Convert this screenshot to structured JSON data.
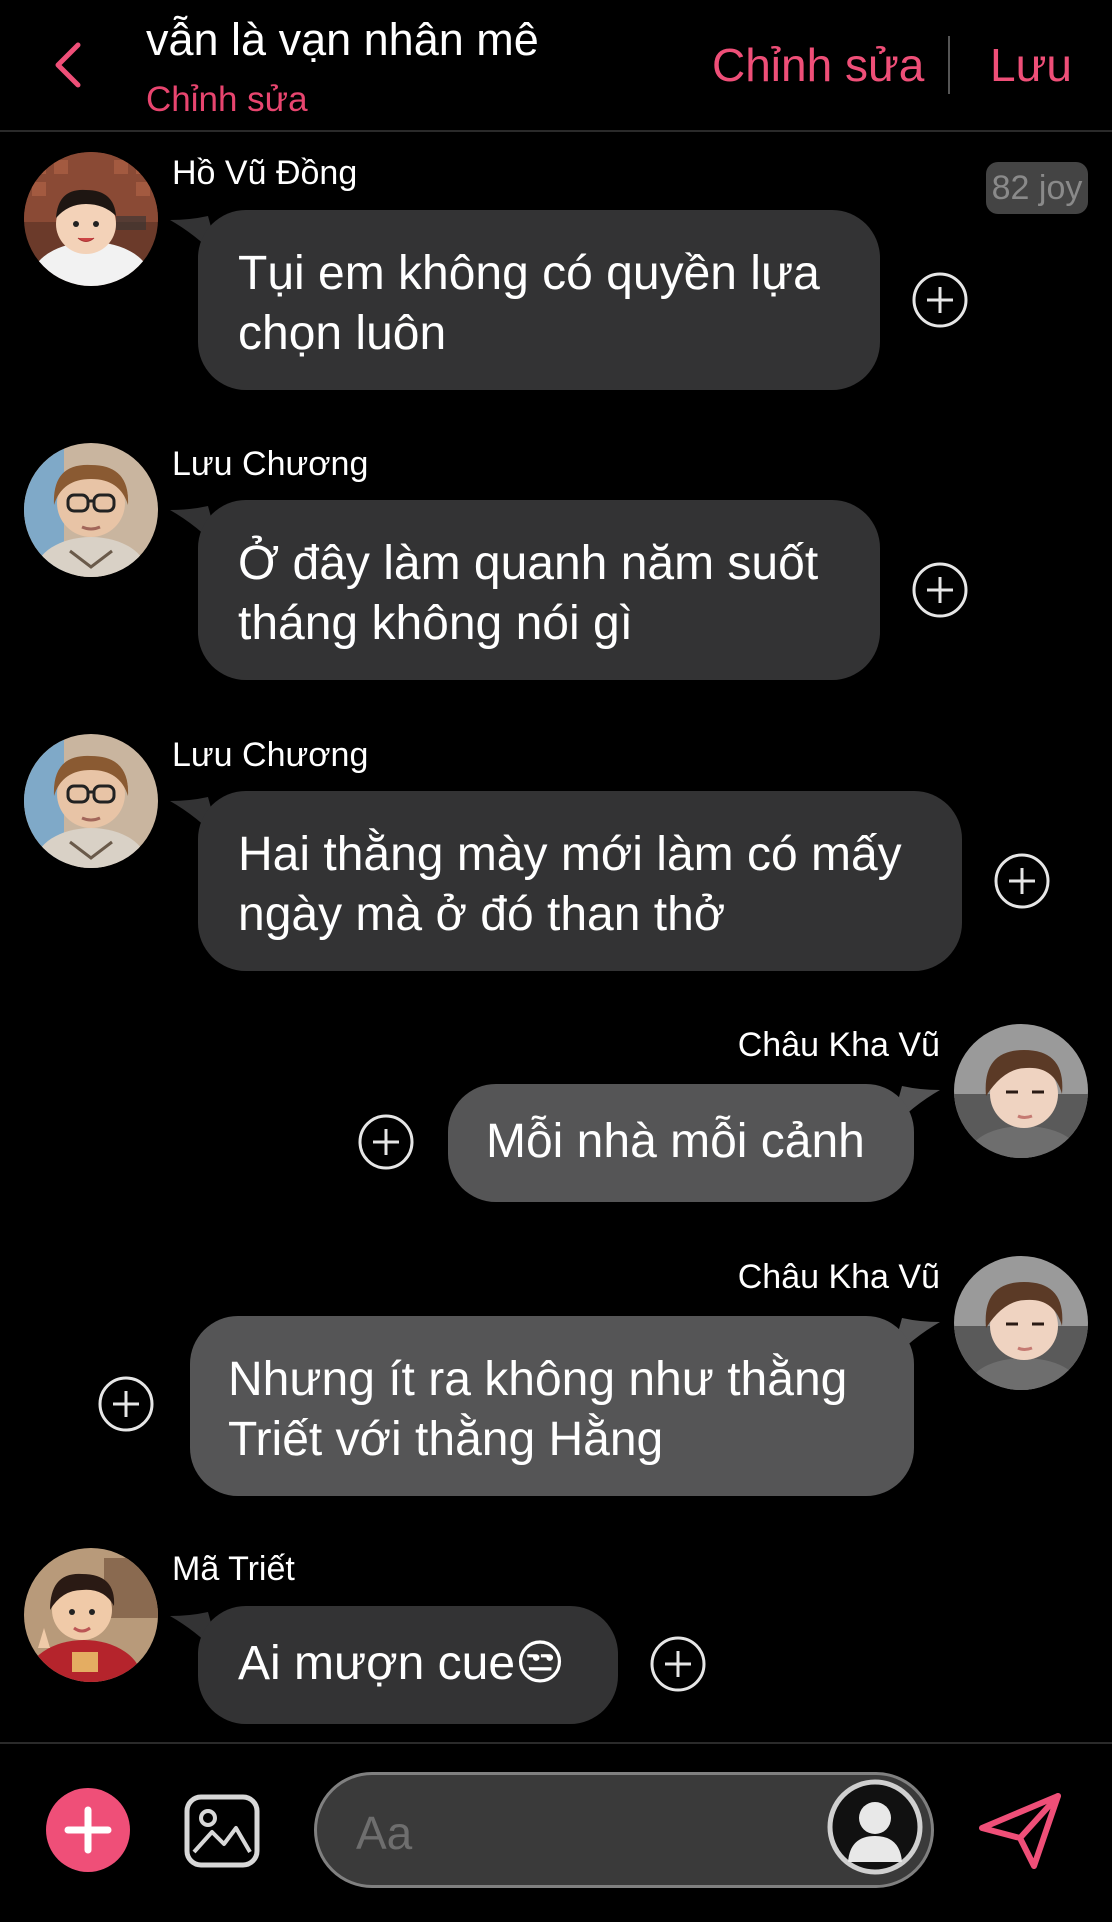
{
  "header": {
    "title": "vẫn là vạn nhân mê",
    "subtitle": "Chỉnh sửa",
    "edit_label": "Chỉnh sửa",
    "save_label": "Lưu",
    "back_icon": "chevron-left-icon"
  },
  "badge": {
    "text": "82 joy"
  },
  "messages": [
    {
      "sender": "Hồ Vũ Đồng",
      "text": [
        "Tụi em không có quyền lựa",
        "chọn luôn"
      ],
      "direction": "incoming"
    },
    {
      "sender": "Lưu Chương",
      "text": [
        "Ở đây làm quanh năm suốt",
        "tháng không nói gì"
      ],
      "direction": "incoming"
    },
    {
      "sender": "Lưu Chương",
      "text": [
        "Hai thằng mày mới làm có mấy",
        "ngày mà ở đó than thở"
      ],
      "direction": "incoming"
    },
    {
      "sender": "Châu Kha Vũ",
      "text": [
        "Mỗi nhà mỗi cảnh"
      ],
      "direction": "outgoing"
    },
    {
      "sender": "Châu Kha Vũ",
      "text": [
        "Nhưng ít ra không như thằng",
        "Triết với thằng Hằng"
      ],
      "direction": "outgoing"
    },
    {
      "sender": "Mã Triết",
      "text": [
        "Ai mượn cue😒"
      ],
      "direction": "incoming"
    }
  ],
  "composer": {
    "placeholder": "Aa",
    "add_icon": "plus-icon",
    "image_icon": "image-icon",
    "send_icon": "send-icon",
    "avatar_icon": "user-silhouette-icon"
  },
  "colors": {
    "accent": "#ef4f78",
    "background": "#000000",
    "incoming_bubble": "#333334",
    "outgoing_bubble": "#555556"
  }
}
